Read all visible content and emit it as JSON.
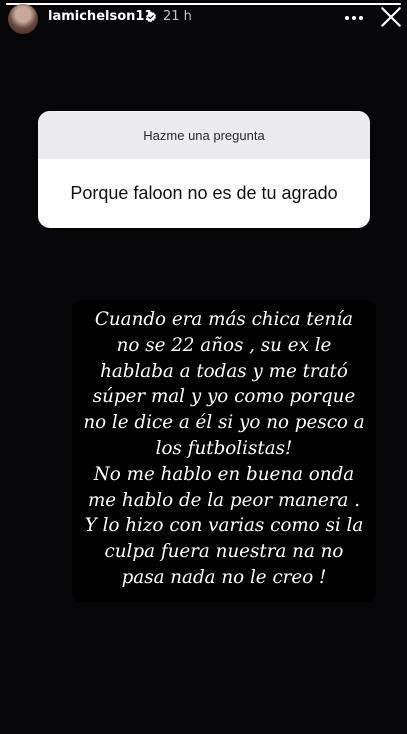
{
  "header": {
    "username": "lamichelson11",
    "time": "21 h",
    "verified_icon": "verified-badge-icon",
    "more_icon": "more-horizontal-icon",
    "close_icon": "close-icon"
  },
  "question_box": {
    "title": "Hazme una pregunta",
    "answer": "Porque faloon no es de tu agrado"
  },
  "story_text": {
    "lines": [
      "Cuando era más chica tenía",
      "no se 22 años , su ex le",
      "hablaba a todas y me trató",
      "súper mal y yo como porque",
      "no le dice a él si yo no pesco a",
      "los futbolistas!",
      "No me hablo en buena onda",
      "me hablo de la peor manera .",
      "Y lo hizo con varias  como si la",
      "culpa fuera nuestra na no",
      "pasa nada no le creo !"
    ]
  },
  "colors": {
    "background": "#060608",
    "card_header": "#ececef",
    "card_body": "#ffffff",
    "text": "#ffffff"
  }
}
